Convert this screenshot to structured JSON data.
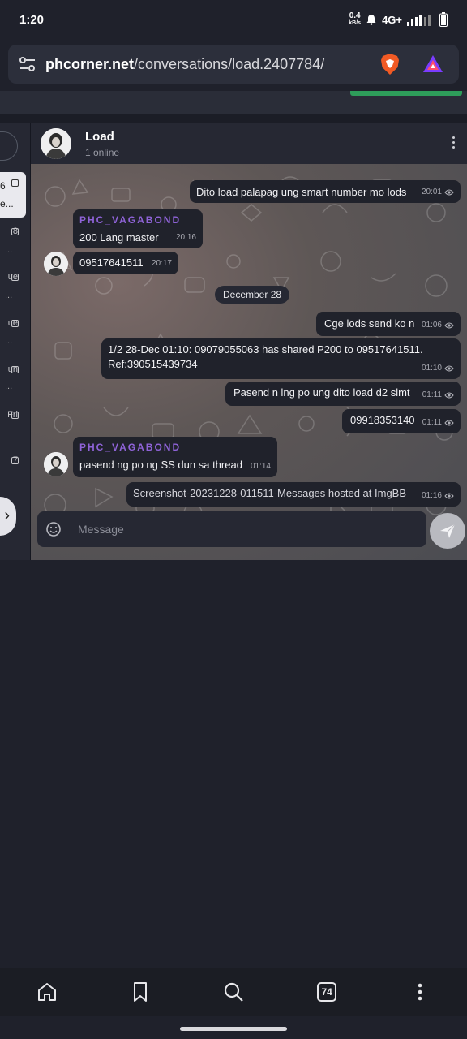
{
  "status_bar": {
    "time": "1:20",
    "net_speed": "0.4",
    "net_unit": "kB/s",
    "network": "4G+"
  },
  "browser": {
    "url_host": "phcorner.net",
    "url_path": "/conversations/load.2407784/",
    "tabs_count": "74"
  },
  "left_panel": {
    "items": [
      {
        "label": "6",
        "sub": "e..."
      },
      {
        "label": "8"
      },
      {
        "label": "ue"
      },
      {
        "label": "ue"
      },
      {
        "label": "un"
      },
      {
        "label": "Fri"
      },
      {
        "label": "7"
      }
    ]
  },
  "chat": {
    "title": "Load",
    "subtitle": "1 online",
    "date_separator": "December 28",
    "composer_placeholder": "Message",
    "messages": [
      {
        "text": "Dito load palapag ung smart number mo lods",
        "time": "20:01"
      },
      {
        "sender": "PHC_VAGABOND",
        "text": "200 Lang master",
        "time": "20:16"
      },
      {
        "text": "09517641511",
        "time": "20:17"
      },
      {
        "text": "Cge lods send ko n",
        "time": "01:06"
      },
      {
        "text": "1/2 28-Dec 01:10: 09079055063 has shared P200 to 09517641511. Ref:390515439734",
        "time": "01:10"
      },
      {
        "text": "Pasend n lng po ung dito load d2 slmt",
        "time": "01:11"
      },
      {
        "text": "09918353140",
        "time": "01:11"
      },
      {
        "sender": "PHC_VAGABOND",
        "text": "pasend ng po ng SS dun sa thread",
        "time": "01:14"
      },
      {
        "text": "Screenshot-20231228-011511-Messages hosted at ImgBB",
        "time": "01:16"
      }
    ]
  }
}
